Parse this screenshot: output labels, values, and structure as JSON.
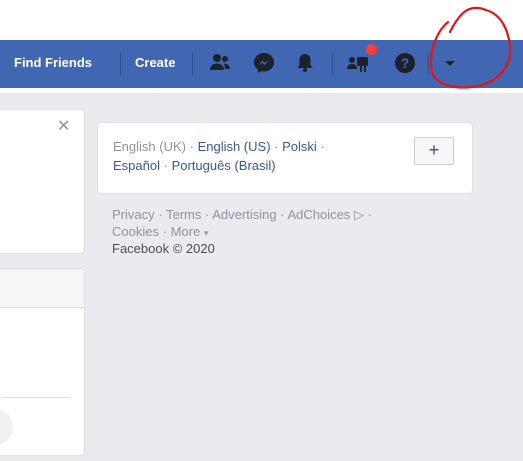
{
  "nav": {
    "find_friends": "Find Friends",
    "create": "Create",
    "icons": [
      "friends-icon",
      "messenger-icon",
      "notifications-bell-icon",
      "quick-help-icon",
      "help-icon",
      "account-menu-caret-icon"
    ],
    "bar_color": "#4267b2",
    "badge_color": "#fa3e3e"
  },
  "annotation": {
    "color": "#e0161b"
  },
  "language": {
    "current": "English (UK)",
    "row1": [
      "English (US)",
      "Polski"
    ],
    "row2": [
      "Español",
      "Português (Brasil)"
    ],
    "add_label": "+",
    "separator": "·"
  },
  "footer": {
    "row1": [
      "Privacy",
      "Terms",
      "Advertising",
      "AdChoices"
    ],
    "row2": [
      "Cookies",
      "More"
    ],
    "copyright": "Facebook © 2020"
  }
}
